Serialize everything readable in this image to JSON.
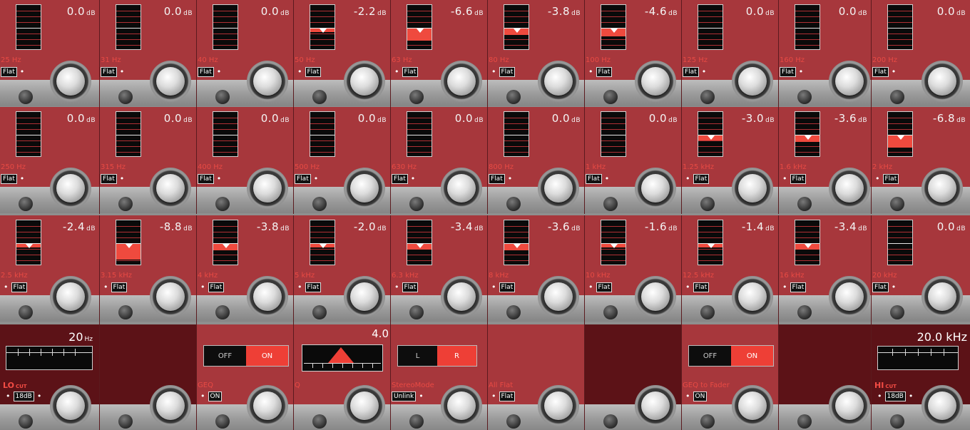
{
  "bands": [
    {
      "freq": "25 Hz",
      "gain": "0.0",
      "tag": "Flat"
    },
    {
      "freq": "31 Hz",
      "gain": "0.0",
      "tag": "Flat"
    },
    {
      "freq": "40 Hz",
      "gain": "0.0",
      "tag": "Flat"
    },
    {
      "freq": "50 Hz",
      "gain": "-2.2",
      "tag": "Flat"
    },
    {
      "freq": "63 Hz",
      "gain": "-6.6",
      "tag": "Flat"
    },
    {
      "freq": "80 Hz",
      "gain": "-3.8",
      "tag": "Flat"
    },
    {
      "freq": "100 Hz",
      "gain": "-4.6",
      "tag": "Flat"
    },
    {
      "freq": "125 Hz",
      "gain": "0.0",
      "tag": "Flat"
    },
    {
      "freq": "160 Hz",
      "gain": "0.0",
      "tag": "Flat"
    },
    {
      "freq": "200 Hz",
      "gain": "0.0",
      "tag": "Flat"
    },
    {
      "freq": "250 Hz",
      "gain": "0.0",
      "tag": "Flat"
    },
    {
      "freq": "315 Hz",
      "gain": "0.0",
      "tag": "Flat"
    },
    {
      "freq": "400 Hz",
      "gain": "0.0",
      "tag": "Flat"
    },
    {
      "freq": "500 Hz",
      "gain": "0.0",
      "tag": "Flat"
    },
    {
      "freq": "630 Hz",
      "gain": "0.0",
      "tag": "Flat"
    },
    {
      "freq": "800 Hz",
      "gain": "0.0",
      "tag": "Flat"
    },
    {
      "freq": "1 kHz",
      "gain": "0.0",
      "tag": "Flat"
    },
    {
      "freq": "1.25 kHz",
      "gain": "-3.0",
      "tag": "Flat"
    },
    {
      "freq": "1.6 kHz",
      "gain": "-3.6",
      "tag": "Flat"
    },
    {
      "freq": "2 kHz",
      "gain": "-6.8",
      "tag": "Flat"
    },
    {
      "freq": "2.5 kHz",
      "gain": "-2.4",
      "tag": "Flat"
    },
    {
      "freq": "3.15 kHz",
      "gain": "-8.8",
      "tag": "Flat"
    },
    {
      "freq": "4 kHz",
      "gain": "-3.8",
      "tag": "Flat"
    },
    {
      "freq": "5 kHz",
      "gain": "-2.0",
      "tag": "Flat"
    },
    {
      "freq": "6.3 kHz",
      "gain": "-3.4",
      "tag": "Flat"
    },
    {
      "freq": "8 kHz",
      "gain": "-3.6",
      "tag": "Flat"
    },
    {
      "freq": "10 kHz",
      "gain": "-1.6",
      "tag": "Flat"
    },
    {
      "freq": "12.5 kHz",
      "gain": "-1.4",
      "tag": "Flat"
    },
    {
      "freq": "16 kHz",
      "gain": "-3.4",
      "tag": "Flat"
    },
    {
      "freq": "20 kHz",
      "gain": "0.0",
      "tag": "Flat"
    }
  ],
  "units": {
    "db": "dB"
  },
  "controls": {
    "lo_cut": {
      "label": "LO",
      "sublabel": "CUT",
      "value": "20",
      "unit": "Hz",
      "tag": "18dB"
    },
    "geq": {
      "label": "GEQ",
      "off": "OFF",
      "on": "ON",
      "tag": "ON"
    },
    "q": {
      "label": "Q",
      "value": "4.0"
    },
    "stereo": {
      "label": "StereoMode",
      "left": "L",
      "right": "R",
      "tag": "Unlink"
    },
    "allflat": {
      "label": "All Flat",
      "tag": "Flat"
    },
    "geq_fader": {
      "label": "GEQ to Fader",
      "off": "OFF",
      "on": "ON",
      "tag": "ON"
    },
    "hi_cut": {
      "label": "HI",
      "sublabel": "CUT",
      "value": "20.0 kHz",
      "tag": "18dB"
    }
  },
  "colors": {
    "panel": "#a7373c",
    "panel_dark": "#5c1217",
    "accent": "#ee3f36"
  }
}
